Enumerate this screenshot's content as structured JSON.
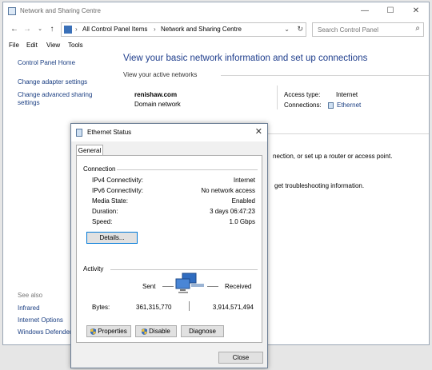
{
  "window": {
    "title": "Network and Sharing Centre",
    "minimize": "—",
    "maximize": "☐",
    "close": "✕"
  },
  "address": {
    "crumbs": [
      "All Control Panel Items",
      "Network and Sharing Centre"
    ],
    "search_placeholder": "Search Control Panel"
  },
  "menu": [
    "File",
    "Edit",
    "View",
    "Tools"
  ],
  "sidebar": {
    "home": "Control Panel Home",
    "links": [
      "Change adapter settings",
      "Change advanced sharing settings"
    ],
    "see_also_title": "See also",
    "see_also": [
      "Infrared",
      "Internet Options",
      "Windows Defender"
    ]
  },
  "main": {
    "heading": "View your basic network information and set up connections",
    "active_networks_label": "View your active networks",
    "network_name": "renishaw.com",
    "network_type": "Domain network",
    "access_type_label": "Access type:",
    "access_type_value": "Internet",
    "connections_label": "Connections:",
    "connections_value": "Ethernet",
    "partial_text_1": "nection, or set up a router or access point.",
    "partial_text_2": "get troubleshooting information."
  },
  "dialog": {
    "title": "Ethernet Status",
    "close": "✕",
    "tab": "General",
    "connection_group": "Connection",
    "rows": [
      {
        "label": "IPv4 Connectivity:",
        "value": "Internet"
      },
      {
        "label": "IPv6 Connectivity:",
        "value": "No network access"
      },
      {
        "label": "Media State:",
        "value": "Enabled"
      },
      {
        "label": "Duration:",
        "value": "3 days 06:47:23"
      },
      {
        "label": "Speed:",
        "value": "1.0 Gbps"
      }
    ],
    "details_button": "Details...",
    "activity_group": "Activity",
    "sent_label": "Sent",
    "received_label": "Received",
    "bytes_label": "Bytes:",
    "bytes_sent": "361,315,770",
    "bytes_received": "3,914,571,494",
    "properties_button": "Properties",
    "disable_button": "Disable",
    "diagnose_button": "Diagnose",
    "close_button": "Close"
  }
}
